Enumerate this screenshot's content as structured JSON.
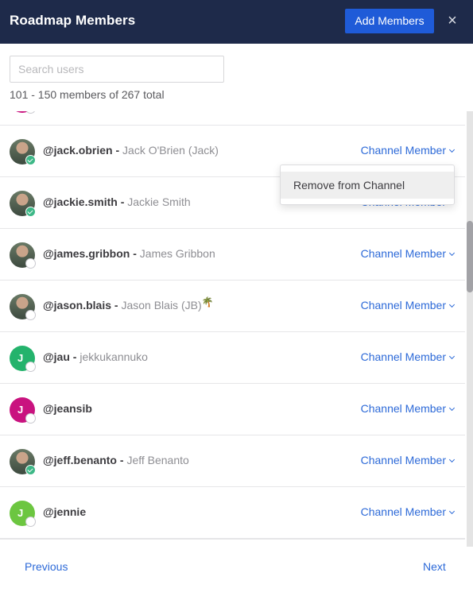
{
  "header": {
    "title": "Roadmap Members",
    "add_button": "Add Members",
    "close_icon": "×"
  },
  "search": {
    "placeholder": "Search users",
    "value": ""
  },
  "count_text": "101 - 150 members of 267 total",
  "members": [
    {
      "username": "@jack.obrien",
      "separator": " - ",
      "fullname": "Jack O'Brien (Jack)",
      "emoji": "",
      "role": "Channel Member",
      "avatar": "photo",
      "initial": "",
      "avatar_color": "",
      "status": "online"
    },
    {
      "username": "@jackie.smith",
      "separator": " - ",
      "fullname": "Jackie Smith",
      "emoji": "",
      "role": "Channel Member",
      "avatar": "photo",
      "initial": "",
      "avatar_color": "",
      "status": "online"
    },
    {
      "username": "@james.gribbon",
      "separator": " - ",
      "fullname": "James Gribbon",
      "emoji": "",
      "role": "Channel Member",
      "avatar": "photo",
      "initial": "",
      "avatar_color": "",
      "status": "offline"
    },
    {
      "username": "@jason.blais",
      "separator": " - ",
      "fullname": "Jason Blais (JB)",
      "emoji": "🌴",
      "role": "Channel Member",
      "avatar": "photo",
      "initial": "",
      "avatar_color": "",
      "status": "offline"
    },
    {
      "username": "@jau",
      "separator": " - ",
      "fullname": "jekkukannuko",
      "emoji": "",
      "role": "Channel Member",
      "avatar": "initial",
      "initial": "J",
      "avatar_color": "#24b36c",
      "status": "offline"
    },
    {
      "username": "@jeansib",
      "separator": "",
      "fullname": "",
      "emoji": "",
      "role": "Channel Member",
      "avatar": "initial",
      "initial": "J",
      "avatar_color": "#c9137f",
      "status": "offline"
    },
    {
      "username": "@jeff.benanto",
      "separator": " - ",
      "fullname": "Jeff Benanto",
      "emoji": "",
      "role": "Channel Member",
      "avatar": "photo",
      "initial": "",
      "avatar_color": "",
      "status": "online"
    },
    {
      "username": "@jennie",
      "separator": "",
      "fullname": "",
      "emoji": "",
      "role": "Channel Member",
      "avatar": "initial",
      "initial": "J",
      "avatar_color": "#6cc640",
      "status": "offline"
    }
  ],
  "dropdown_menu": {
    "open_for": "@jack.obrien",
    "items": [
      "Remove from Channel"
    ]
  },
  "pagination": {
    "previous": "Previous",
    "next": "Next"
  },
  "colors": {
    "header_bg": "#1e2a4a",
    "primary": "#1f5bd8",
    "link": "#2d6ad8",
    "online": "#3db887"
  }
}
